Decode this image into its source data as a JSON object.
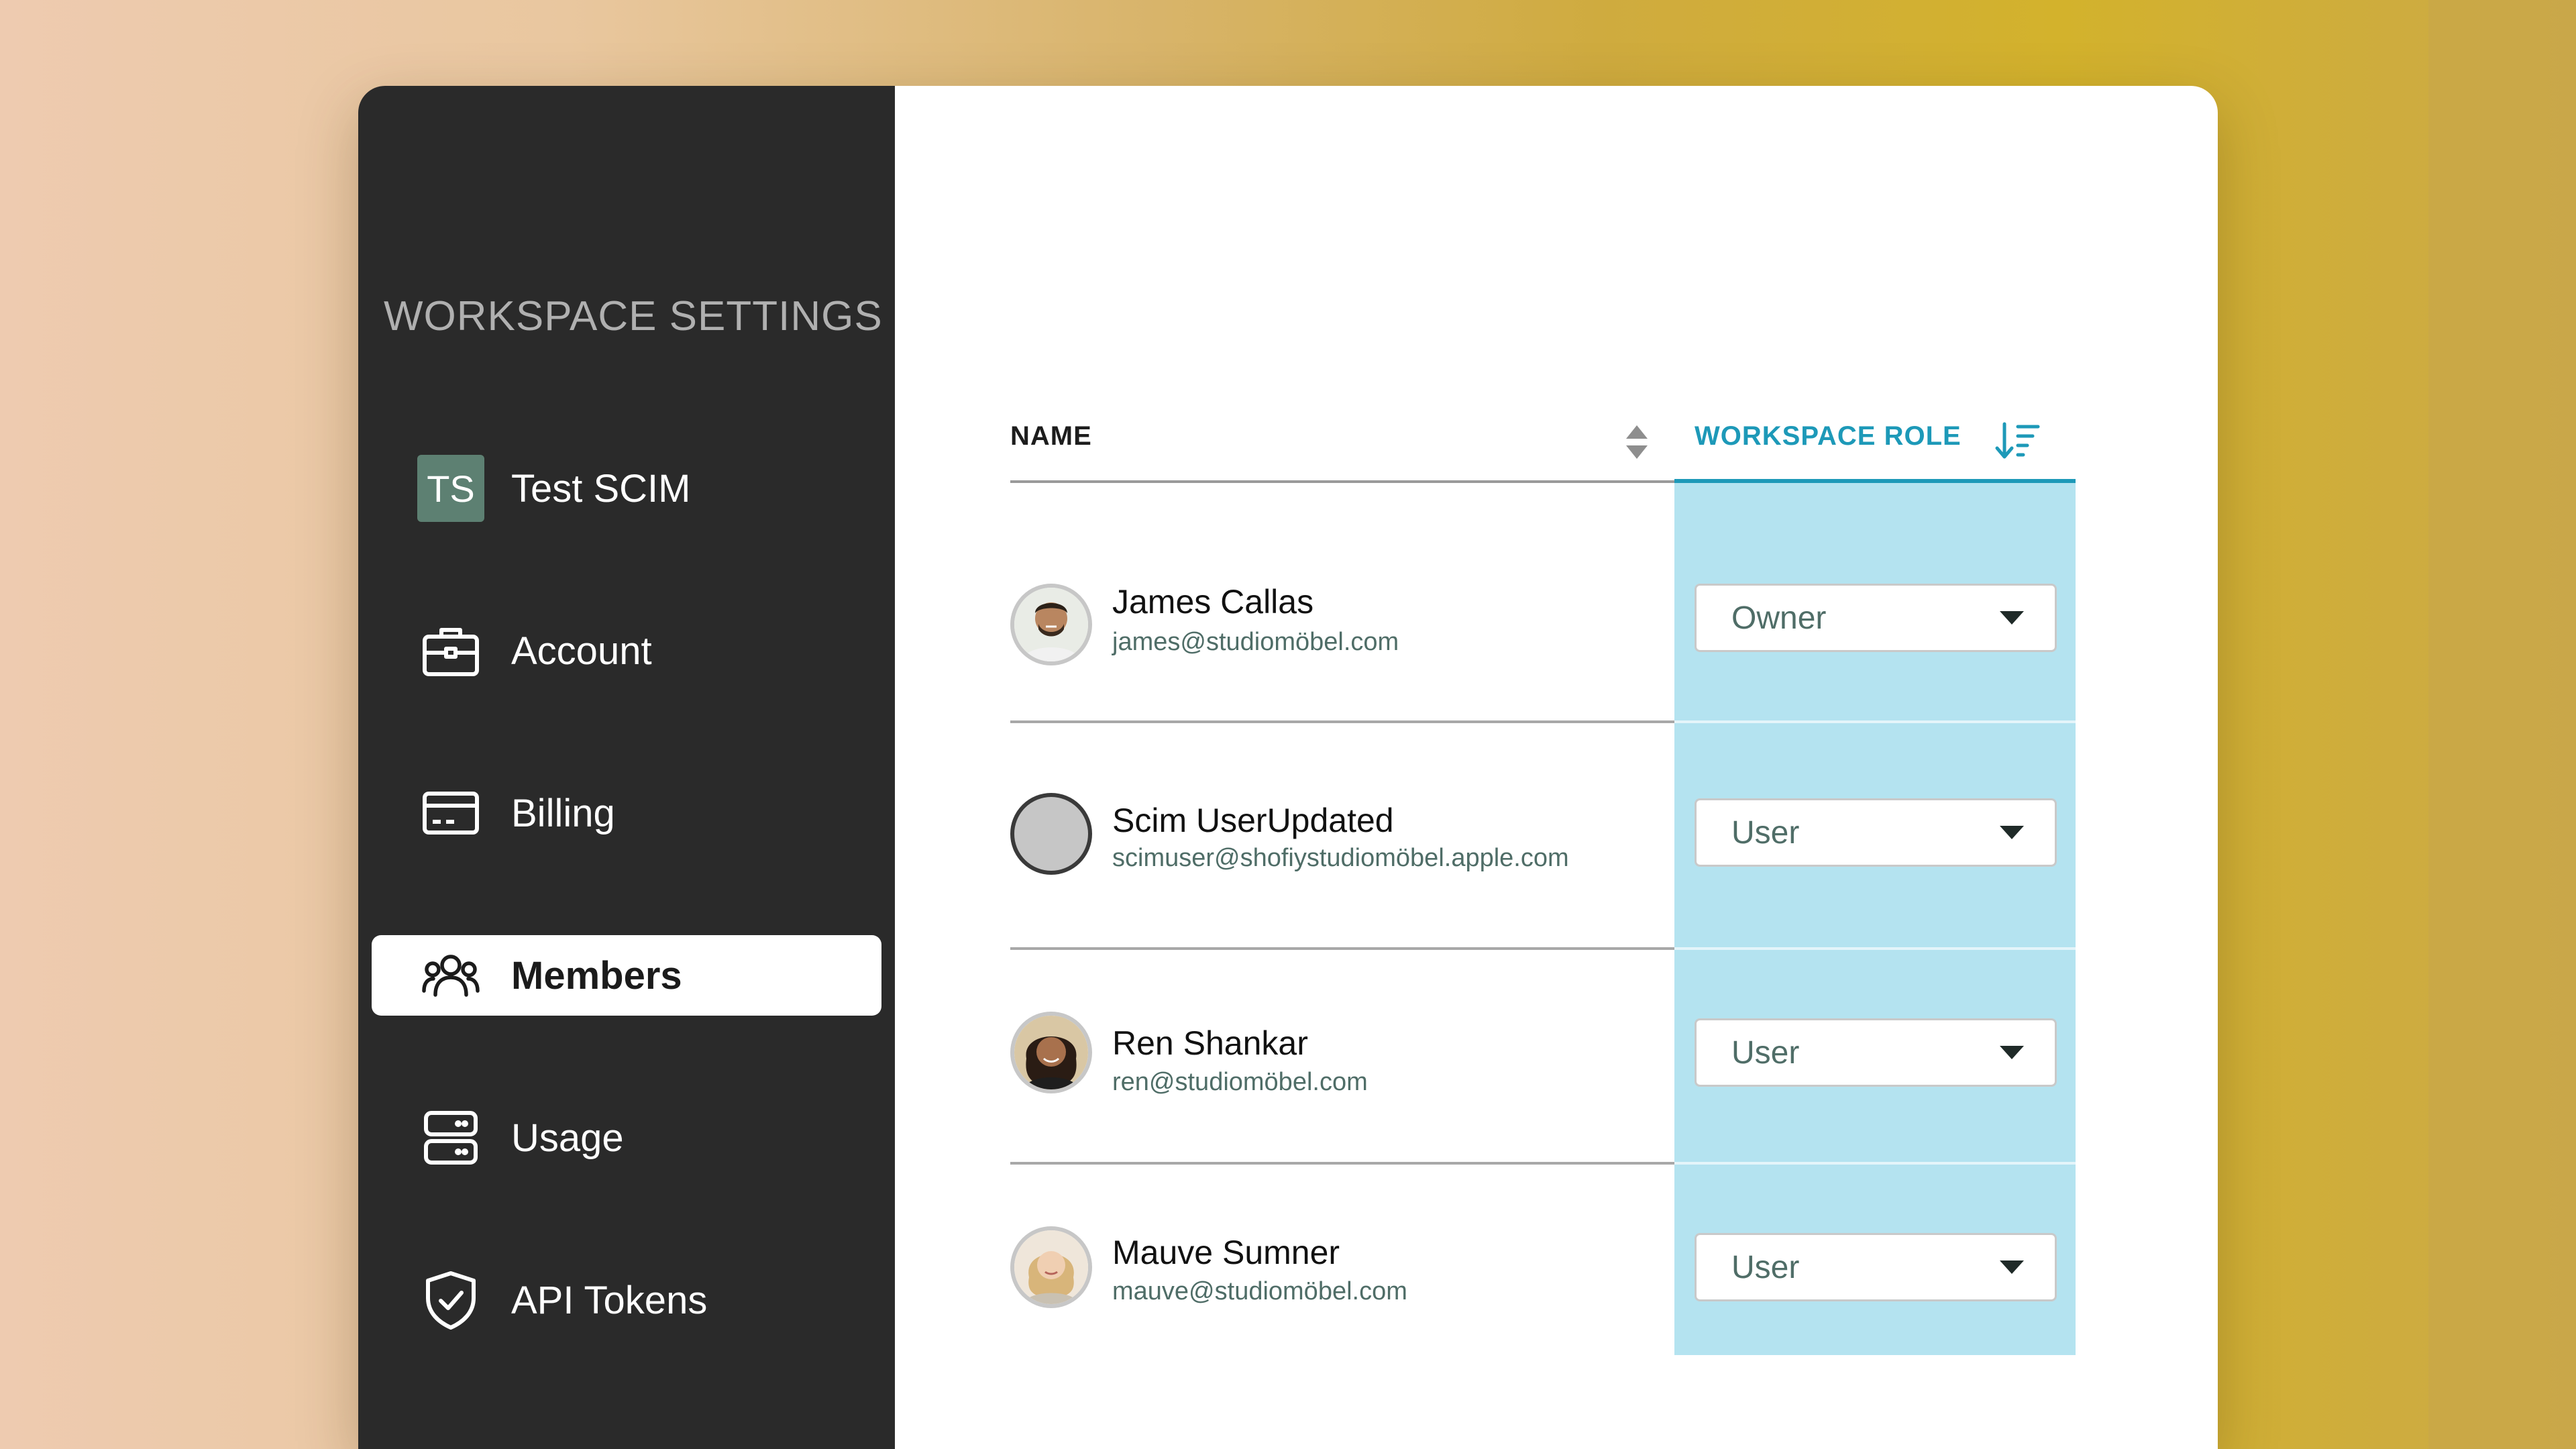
{
  "sidebar": {
    "title": "WORKSPACE SETTINGS",
    "items": [
      {
        "label": "Test SCIM",
        "badge": "TS",
        "icon": "workspace-badge"
      },
      {
        "label": "Account",
        "icon": "briefcase-icon"
      },
      {
        "label": "Billing",
        "icon": "credit-card-icon"
      },
      {
        "label": "Members",
        "icon": "users-icon",
        "active": true
      },
      {
        "label": "Usage",
        "icon": "server-icon"
      },
      {
        "label": "API Tokens",
        "icon": "shield-check-icon"
      }
    ]
  },
  "table": {
    "headers": {
      "name": "NAME",
      "role": "WORKSPACE ROLE"
    },
    "rows": [
      {
        "name": "James Callas",
        "email": "james@studiomöbel.com",
        "role": "Owner",
        "avatar": "photo"
      },
      {
        "name": "Scim UserUpdated",
        "email": "scimuser@shofiystudiomöbel.apple.com",
        "role": "User",
        "avatar": "placeholder"
      },
      {
        "name": "Ren Shankar",
        "email": "ren@studiomöbel.com",
        "role": "User",
        "avatar": "photo"
      },
      {
        "name": "Mauve Sumner",
        "email": "mauve@studiomöbel.com",
        "role": "User",
        "avatar": "photo"
      }
    ]
  },
  "colors": {
    "sidebar_bg": "#2a2a2a",
    "accent": "#1d99b8",
    "role_column_bg": "#b4e3f0",
    "badge_bg": "#5d8072"
  }
}
